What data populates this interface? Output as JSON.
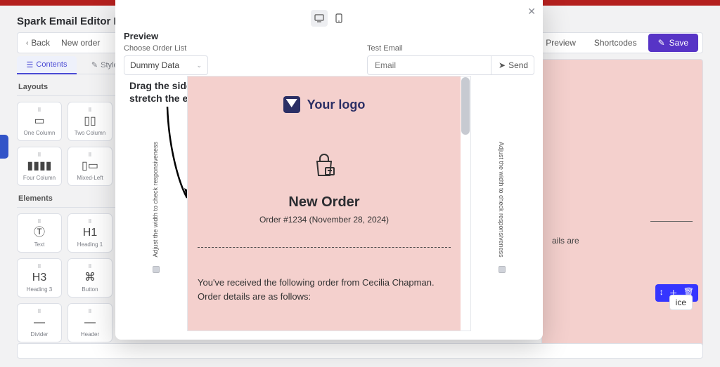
{
  "app": {
    "title": "Spark Email Editor Pro"
  },
  "toolbar": {
    "back": "Back",
    "crumb": "New order",
    "preview": "Preview",
    "shortcodes": "Shortcodes",
    "save": "Save"
  },
  "sidebar": {
    "tabs": {
      "contents": "Contents",
      "styles": "Styles"
    },
    "layouts_label": "Layouts",
    "elements_label": "Elements",
    "blocks": {
      "one_column": "One Column",
      "two_column": "Two Column",
      "four_column": "Four Column",
      "mixed_left": "Mixed-Left",
      "text": "Text",
      "heading1": "Heading 1",
      "heading3": "Heading 3",
      "button": "Button",
      "divider": "Divider",
      "header": "Header"
    },
    "glyphs": {
      "h1": "H1",
      "h3": "H3"
    }
  },
  "modal": {
    "preview_label": "Preview",
    "choose_list": "Choose Order List",
    "select_value": "Dummy Data",
    "test_email": "Test Email",
    "email_placeholder": "Email",
    "send": "Send",
    "hint_l1": "Drag the sides and",
    "hint_l2": "stretch the email template",
    "rail_text": "Adjust the width to check responsiveness"
  },
  "email": {
    "logo_text": "Your logo",
    "heading": "New Order",
    "order_line": "Order #1234 (November 28, 2024)",
    "body": "You've received the following order from Cecilia Chapman. Order details are as follows:"
  },
  "canvas_peek": {
    "msg": "ails are",
    "chip": "ice"
  }
}
